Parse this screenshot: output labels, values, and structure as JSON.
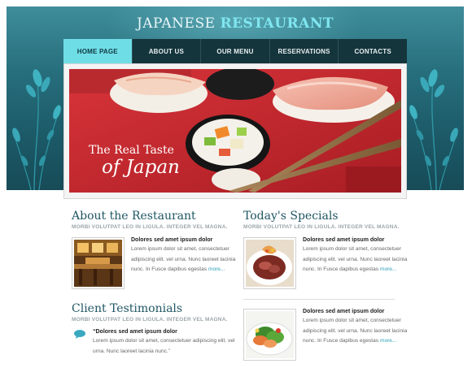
{
  "site": {
    "title_part1": "Japanese",
    "title_part2": "Restaurant"
  },
  "nav": {
    "items": [
      {
        "label": "HOME PAGE",
        "active": true
      },
      {
        "label": "ABOUT US",
        "active": false
      },
      {
        "label": "OUR MENU",
        "active": false
      },
      {
        "label": "RESERVATIONS",
        "active": false
      },
      {
        "label": "CONTACTS",
        "active": false
      }
    ]
  },
  "hero": {
    "tagline_line1": "The Real Taste",
    "tagline_line2": "of Japan"
  },
  "about": {
    "title": "About the Restaurant",
    "subtitle": "MORBI VOLUTPAT LEO IN LIGULA. INTEGER VEL MAGNA.",
    "item": {
      "heading": "Dolores sed amet ipsum dolor",
      "body": "Lorem ipsum dolor sit amet, consectetuer adipiscing elit. vel urna. Nunc laoreet lacinia nunc. In Fusce dapibus egestas",
      "more": "more..."
    }
  },
  "specials": {
    "title": "Today's Specials",
    "subtitle": "MORBI VOLUTPAT LEO IN LIGULA. INTEGER VEL MAGNA.",
    "items": [
      {
        "heading": "Dolores sed amet ipsum dolor",
        "body": "Lorem ipsum dolor sit amet, consectetuer adipiscing elit. vel urna. Nunc laoreet lacinia nunc. In Fusce dapibus egestas",
        "more": "more..."
      },
      {
        "heading": "Dolores sed amet ipsum dolor",
        "body": "Lorem ipsum dolor sit amet, consectetuer adipiscing elit. vel urna. Nunc laoreet lacinia nunc. In Fusce dapibus egestas",
        "more": "more..."
      }
    ]
  },
  "testimonials": {
    "title": "Client Testimonials",
    "subtitle": "MORBI VOLUTPAT LEO IN LIGULA. INTEGER VEL MAGNA.",
    "quote": {
      "heading": "“Dolores sed amet ipsum dolor",
      "body": "Lorem ipsum dolor sit amet, consectetuer adipiscing elit. vel urna. Nunc laoreet lacinia nunc.”"
    }
  },
  "colors": {
    "header_teal": "#276f7d",
    "nav_dark": "#15353c",
    "nav_active": "#6fdde6",
    "title_accent": "#7fe6f0",
    "heading_text": "#1f5663",
    "link": "#2a9fb5",
    "hero_red": "#c8272d"
  },
  "icons": [
    "leaf-plant-decoration",
    "speech-bubble-icon"
  ]
}
